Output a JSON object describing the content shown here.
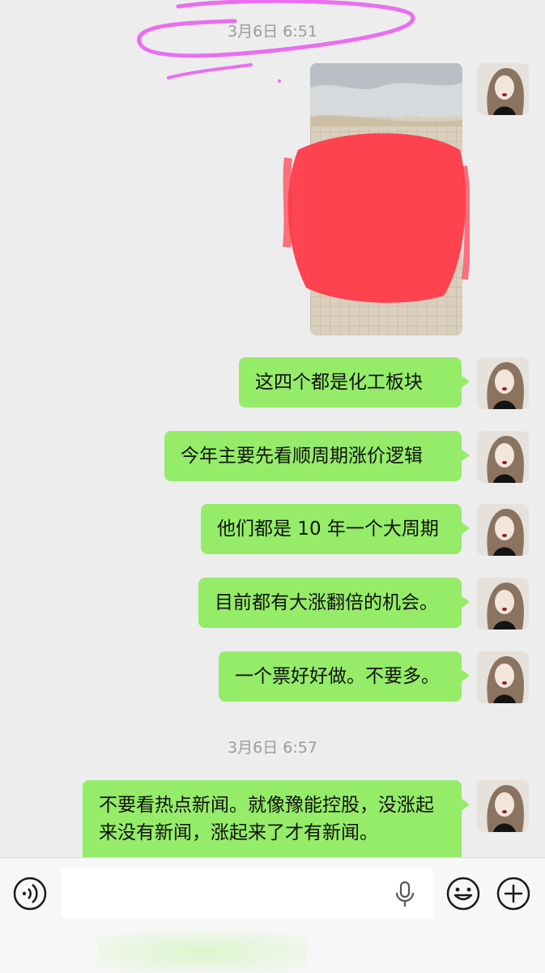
{
  "chat": {
    "timestamps": [
      "3月6日 6:51",
      "3月6日 6:57"
    ],
    "messages": [
      "这四个都是化工板块",
      "今年主要先看顺周期涨价逻辑",
      "他们都是 10 年一个大周期",
      "目前都有大涨翻倍的机会。",
      "一个票好好做。不要多。",
      "不要看热点新闻。就像豫能控股，没涨起来没有新闻，涨起来了才有新闻。"
    ]
  },
  "input": {
    "value": "",
    "placeholder": ""
  },
  "icons": {
    "voice": "voice-mode-icon",
    "mic": "microphone-icon",
    "emoji": "emoji-icon",
    "plus": "plus-icon"
  },
  "colors": {
    "bubble": "#95ec69",
    "background": "#ededed",
    "redaction": "#ff3a4a",
    "circle_annotation": "#e96ef0"
  }
}
